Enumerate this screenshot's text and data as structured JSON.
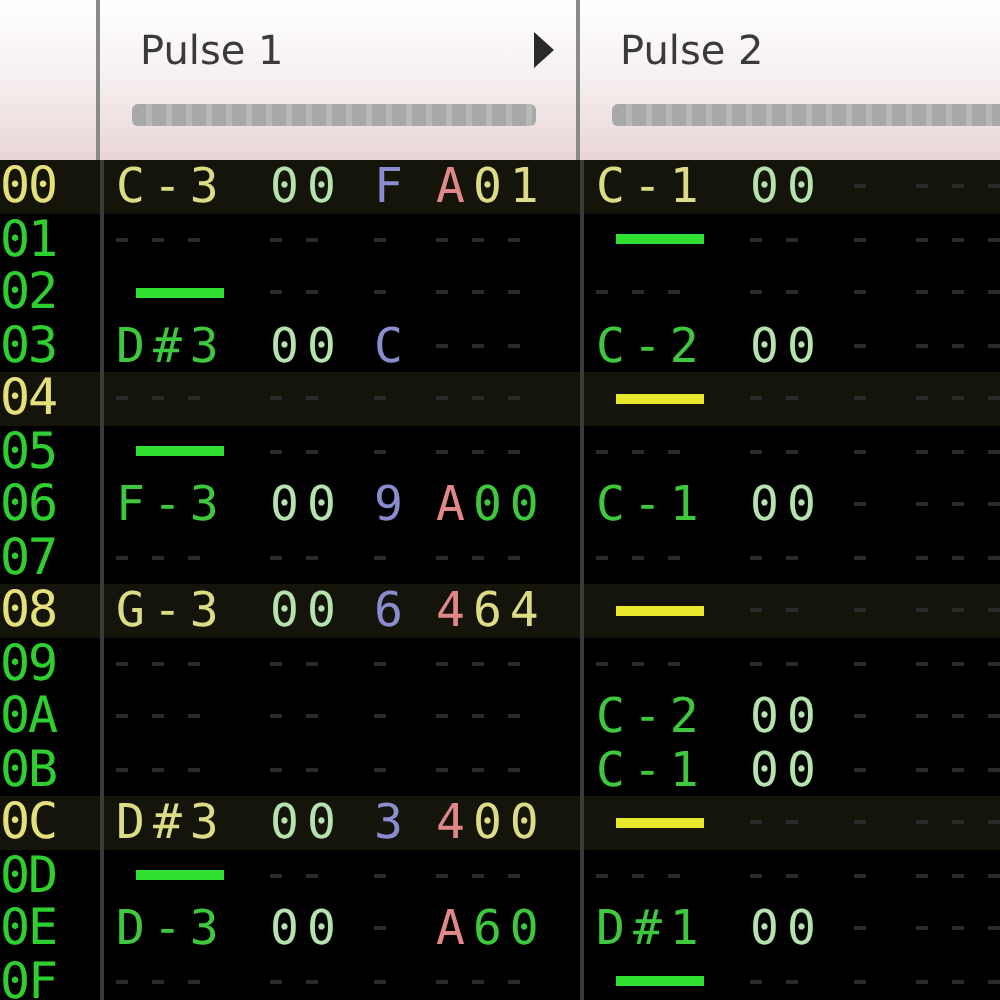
{
  "channels": [
    {
      "name": "Pulse 1"
    },
    {
      "name": "Pulse 2"
    }
  ],
  "rows": [
    {
      "number": "00",
      "highlighted": true,
      "cells": [
        {
          "kind": "note",
          "note": "C-3",
          "instrument": "00",
          "volume": "F",
          "effect": "A01"
        },
        {
          "kind": "note",
          "note": "C-1",
          "instrument": "00"
        }
      ]
    },
    {
      "number": "01",
      "highlighted": false,
      "cells": [
        {
          "kind": "empty"
        },
        {
          "kind": "off"
        }
      ]
    },
    {
      "number": "02",
      "highlighted": false,
      "cells": [
        {
          "kind": "off"
        },
        {
          "kind": "empty"
        }
      ]
    },
    {
      "number": "03",
      "highlighted": false,
      "cells": [
        {
          "kind": "note",
          "note": "D#3",
          "instrument": "00",
          "volume": "C"
        },
        {
          "kind": "note",
          "note": "C-2",
          "instrument": "00"
        }
      ]
    },
    {
      "number": "04",
      "highlighted": true,
      "cells": [
        {
          "kind": "empty"
        },
        {
          "kind": "off"
        }
      ]
    },
    {
      "number": "05",
      "highlighted": false,
      "cells": [
        {
          "kind": "off"
        },
        {
          "kind": "empty"
        }
      ]
    },
    {
      "number": "06",
      "highlighted": false,
      "cells": [
        {
          "kind": "note",
          "note": "F-3",
          "instrument": "00",
          "volume": "9",
          "effect": "A00"
        },
        {
          "kind": "note",
          "note": "C-1",
          "instrument": "00"
        }
      ]
    },
    {
      "number": "07",
      "highlighted": false,
      "cells": [
        {
          "kind": "empty"
        },
        {
          "kind": "empty"
        }
      ]
    },
    {
      "number": "08",
      "highlighted": true,
      "cells": [
        {
          "kind": "note",
          "note": "G-3",
          "instrument": "00",
          "volume": "6",
          "effect": "464"
        },
        {
          "kind": "off"
        }
      ]
    },
    {
      "number": "09",
      "highlighted": false,
      "cells": [
        {
          "kind": "empty"
        },
        {
          "kind": "empty"
        }
      ]
    },
    {
      "number": "0A",
      "highlighted": false,
      "cells": [
        {
          "kind": "empty"
        },
        {
          "kind": "note",
          "note": "C-2",
          "instrument": "00"
        }
      ]
    },
    {
      "number": "0B",
      "highlighted": false,
      "cells": [
        {
          "kind": "empty"
        },
        {
          "kind": "note",
          "note": "C-1",
          "instrument": "00"
        }
      ]
    },
    {
      "number": "0C",
      "highlighted": true,
      "cells": [
        {
          "kind": "note",
          "note": "D#3",
          "instrument": "00",
          "volume": "3",
          "effect": "400"
        },
        {
          "kind": "off"
        }
      ]
    },
    {
      "number": "0D",
      "highlighted": false,
      "cells": [
        {
          "kind": "off"
        },
        {
          "kind": "empty"
        }
      ]
    },
    {
      "number": "0E",
      "highlighted": false,
      "cells": [
        {
          "kind": "note",
          "note": "D-3",
          "instrument": "00",
          "effect": "A60"
        },
        {
          "kind": "note",
          "note": "D#1",
          "instrument": "00"
        }
      ]
    },
    {
      "number": "0F",
      "highlighted": false,
      "cells": [
        {
          "kind": "empty"
        },
        {
          "kind": "off"
        }
      ]
    }
  ]
}
